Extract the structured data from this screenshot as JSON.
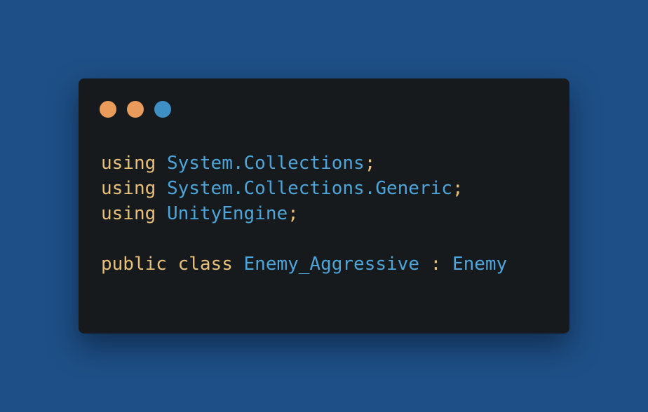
{
  "colors": {
    "background": "#1e4f86",
    "editor_background": "#161a1d",
    "keyword": "#e8c07a",
    "identifier": "#4ea5d9",
    "dot_1": "#e89b5a",
    "dot_2": "#e89b5a",
    "dot_3": "#3e8fc4"
  },
  "window_controls": [
    {
      "name": "close-button"
    },
    {
      "name": "minimize-button"
    },
    {
      "name": "maximize-button"
    }
  ],
  "code": {
    "line1": {
      "keyword": "using",
      "identifier": "System.Collections",
      "punct": ";"
    },
    "line2": {
      "keyword": "using",
      "identifier": "System.Collections.Generic",
      "punct": ";"
    },
    "line3": {
      "keyword": "using",
      "identifier": "UnityEngine",
      "punct": ";"
    },
    "line5": {
      "keyword1": "public",
      "keyword2": "class",
      "class_name": "Enemy_Aggressive",
      "colon": ":",
      "base_class": "Enemy"
    }
  }
}
